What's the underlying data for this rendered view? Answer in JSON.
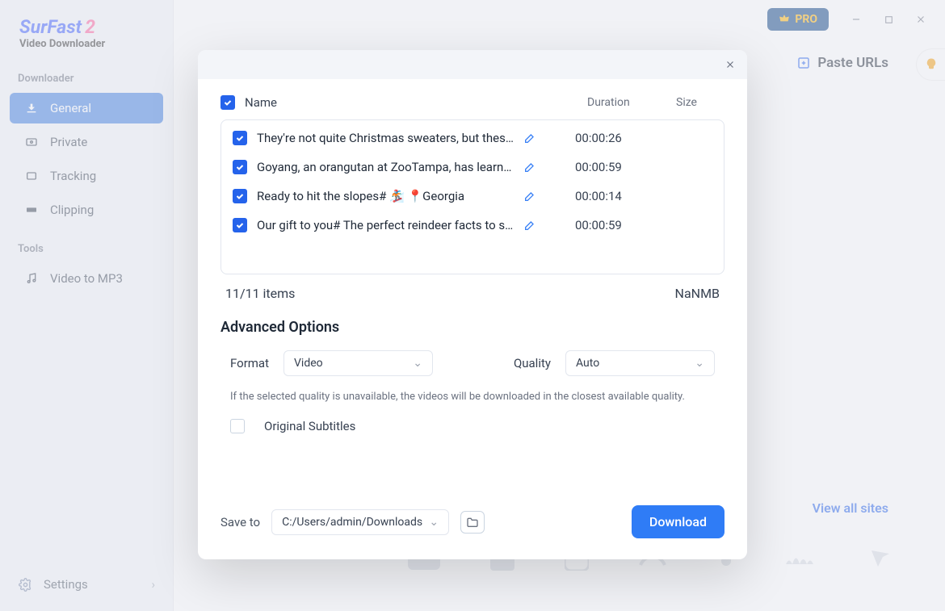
{
  "app": {
    "logo_main": "SurFast",
    "logo_num": "2",
    "logo_sub": "Video Downloader"
  },
  "titlebar": {
    "pro": "PRO"
  },
  "sidebar": {
    "section1": "Downloader",
    "section2": "Tools",
    "general": "General",
    "private": "Private",
    "tracking": "Tracking",
    "clipping": "Clipping",
    "video_to_mp3": "Video to MP3",
    "settings": "Settings"
  },
  "header": {
    "paste_urls": "Paste URLs",
    "view_all_sites": "View all sites"
  },
  "modal": {
    "head_name": "Name",
    "head_duration": "Duration",
    "head_size": "Size",
    "items": [
      {
        "title": "They're not quite Christmas sweaters, but thes…",
        "duration": "00:00:26"
      },
      {
        "title": "Goyang, an orangutan at ZooTampa, has learn…",
        "duration": "00:00:59"
      },
      {
        "title": "Ready to hit the slopes# 🏂 📍Georgia",
        "duration": "00:00:14"
      },
      {
        "title": "Our gift to you# The perfect reindeer facts to s…",
        "duration": "00:00:59"
      }
    ],
    "count_text": "11/11 items",
    "total_size": "NaNMB",
    "advanced_title": "Advanced Options",
    "format_label": "Format",
    "format_value": "Video",
    "quality_label": "Quality",
    "quality_value": "Auto",
    "quality_note": "If the selected quality is unavailable, the videos will be downloaded in the closest available quality.",
    "subtitles_label": "Original Subtitles",
    "save_to_label": "Save to",
    "save_path": "C:/Users/admin/Downloads",
    "download_btn": "Download"
  }
}
